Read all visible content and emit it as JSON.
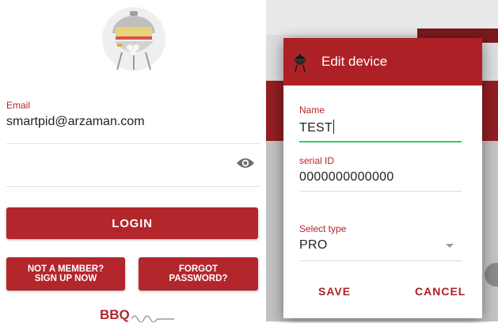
{
  "login": {
    "email_label": "Email",
    "email_value": "smartpid@arzaman.com",
    "password_value": "",
    "login_label": "LOGIN",
    "signup_line1": "NOT A MEMBER?",
    "signup_line2": "SIGN UP NOW",
    "forgot_line1": "FORGOT",
    "forgot_line2": "PASSWORD?",
    "bottom_brand": "BBQ",
    "icons": [
      "bbq-grill-logo",
      "eye-icon"
    ]
  },
  "dialog": {
    "title": "Edit device",
    "name_label": "Name",
    "name_value": "TEST",
    "serial_label": "serial ID",
    "serial_value": "0000000000000",
    "type_label": "Select type",
    "type_value": "PRO",
    "save_label": "SAVE",
    "cancel_label": "CANCEL",
    "icons": [
      "grill-icon",
      "chevron-down-icon"
    ]
  },
  "colors": {
    "brand_red": "#ad2126",
    "focus_green": "#36c86a",
    "label_red": "#b8262b"
  }
}
